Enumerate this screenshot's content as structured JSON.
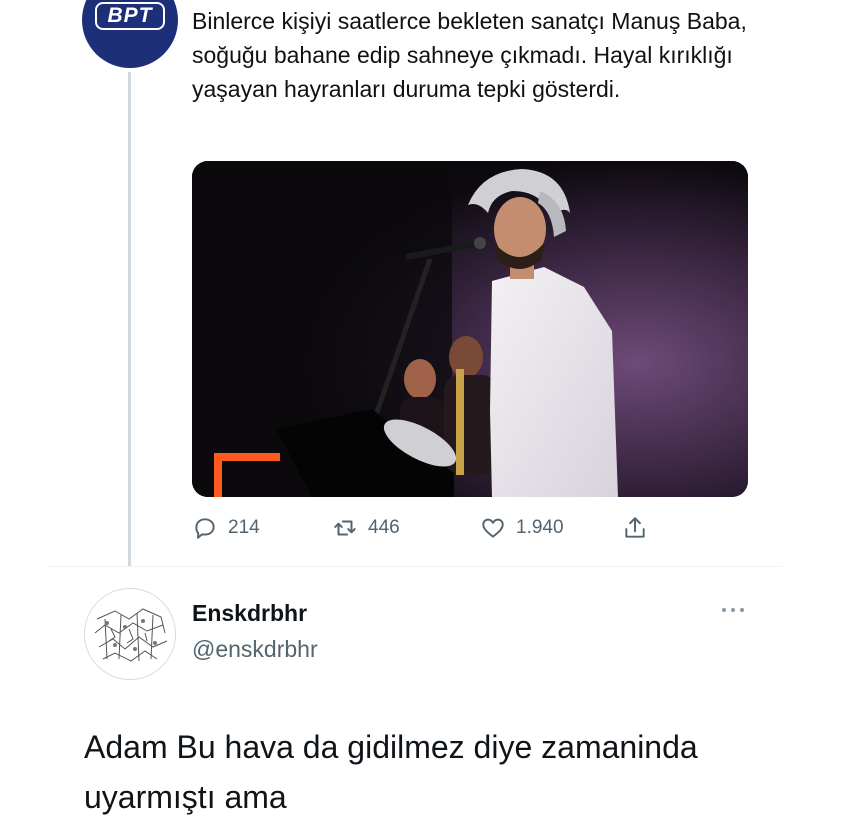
{
  "tweet": {
    "logo_text": "BPT",
    "text": "Binlerce kişiyi saatlerce bekleten sanatçı Manuş Baba, soğuğu bahane edip sahneye çıkmadı. Hayal kırıklığı yaşayan hayranları duruma tepki gösterdi.",
    "media_icon": "concert-photo",
    "actions": {
      "reply_icon": "reply-icon",
      "reply_count": "214",
      "retweet_icon": "retweet-icon",
      "retweet_count": "446",
      "like_icon": "heart-icon",
      "like_count": "1.940",
      "share_icon": "share-icon"
    }
  },
  "reply": {
    "display_name": "Enskdrbhr",
    "handle": "@enskdrbhr",
    "more_icon": "more-icon",
    "text": "Adam Bu hava da gidilmez diye zamaninda uyarmıştı ama"
  },
  "colors": {
    "avatar_bg": "#1e2f7a",
    "muted_text": "#536471",
    "thread_line": "#cfd9de"
  }
}
